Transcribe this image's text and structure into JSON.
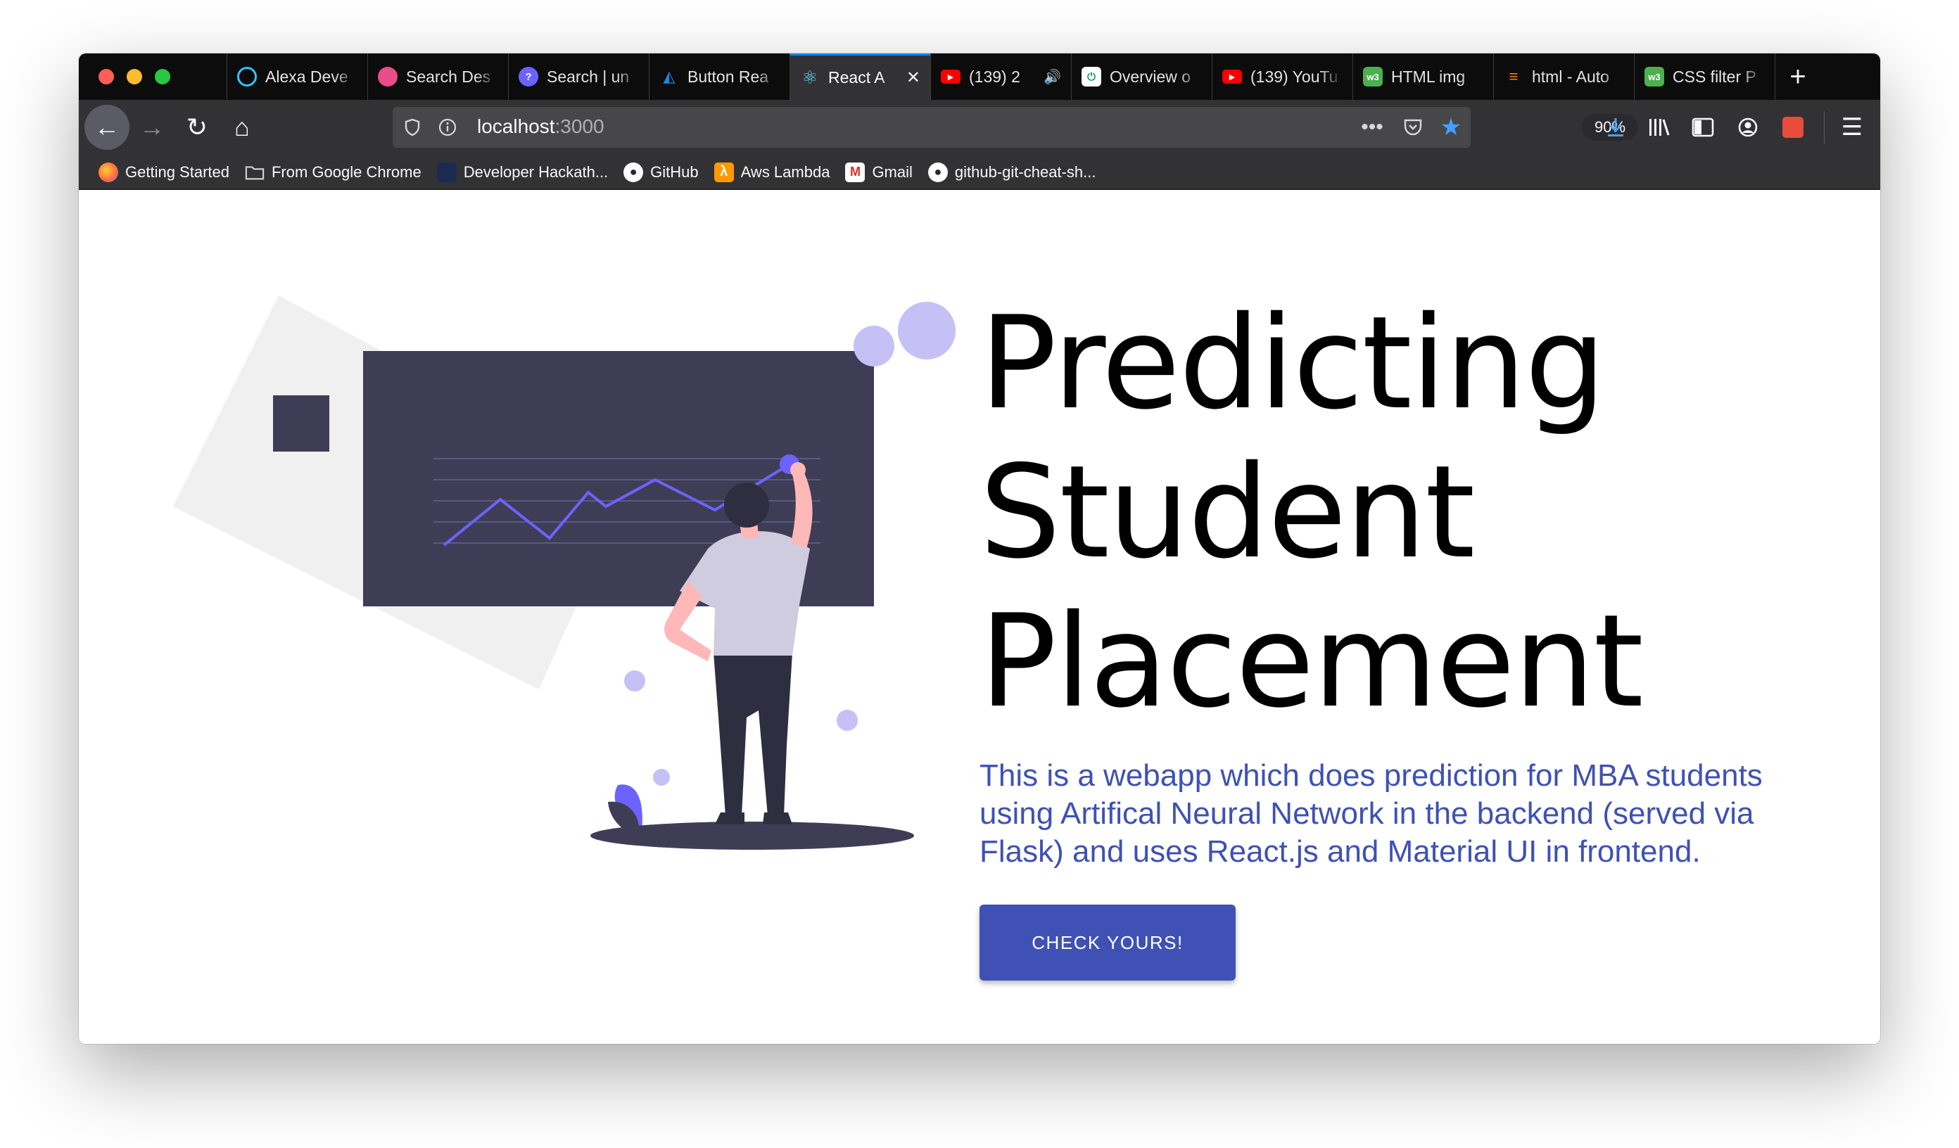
{
  "tabs": [
    {
      "title": "Alexa Deve",
      "icon": "alexa-icon",
      "color": "#31c4f3",
      "active": false
    },
    {
      "title": "Search Des",
      "icon": "dribbble-icon",
      "color": "#ea4c89",
      "active": false
    },
    {
      "title": "Search | un",
      "icon": "search-site-icon",
      "color": "#6c63ff",
      "active": false
    },
    {
      "title": "Button Rea",
      "icon": "material-ui-icon",
      "color": "#1e88e5",
      "active": false
    },
    {
      "title": "React A",
      "icon": "react-icon",
      "color": "#61dafb",
      "active": true
    },
    {
      "title": "(139) 2",
      "icon": "youtube-icon",
      "color": "#ff0000",
      "active": false
    },
    {
      "title": "Overview o",
      "icon": "overview-icon",
      "color": "#1aa260",
      "active": false
    },
    {
      "title": "(139) YouTu",
      "icon": "youtube-icon",
      "color": "#ff0000",
      "active": false
    },
    {
      "title": "HTML img",
      "icon": "w3schools-icon",
      "color": "#4caf50",
      "active": false
    },
    {
      "title": "html - Auto",
      "icon": "stackoverflow-icon",
      "color": "#f48024",
      "active": false
    },
    {
      "title": "CSS filter P",
      "icon": "w3schools-icon",
      "color": "#4caf50",
      "active": false
    }
  ],
  "tab_aside": {
    "close_glyph": "✕",
    "speaker_glyph": "🔊"
  },
  "new_tab_glyph": "+",
  "nav": {
    "back": "←",
    "forward": "→",
    "reload": "↻",
    "home": "⌂"
  },
  "url": {
    "host": "localhost",
    "port": ":3000",
    "zoom": "90%"
  },
  "bookmarks": [
    {
      "label": "Getting Started",
      "icon": "firefox-icon",
      "color": "#ff7139"
    },
    {
      "label": "From Google Chrome",
      "icon": "folder-icon",
      "color": "#d7d7db"
    },
    {
      "label": "Developer Hackath...",
      "icon": "devpost-icon",
      "color": "#003e54"
    },
    {
      "label": "GitHub",
      "icon": "github-icon",
      "color": "#ffffff"
    },
    {
      "label": "Aws Lambda",
      "icon": "aws-lambda-icon",
      "color": "#f90000"
    },
    {
      "label": "Gmail",
      "icon": "gmail-icon",
      "color": "#d93025"
    },
    {
      "label": "github-git-cheat-sh...",
      "icon": "github-icon",
      "color": "#ffffff"
    }
  ],
  "hero": {
    "title_lines": [
      "Predicting",
      "Student",
      "Placement"
    ],
    "description": "This is a webapp which does prediction for MBA students using Artifical Neural Network in the backend (served via Flask) and uses React.js and Material UI in frontend.",
    "button_label": "CHECK YOURS!"
  },
  "colors": {
    "primary": "#3f51b5",
    "board": "#3f3d56",
    "accent": "#6c63ff",
    "accent_light": "#c5c1f7",
    "shirt": "#cfcce0",
    "skin": "#ffb8b8"
  }
}
